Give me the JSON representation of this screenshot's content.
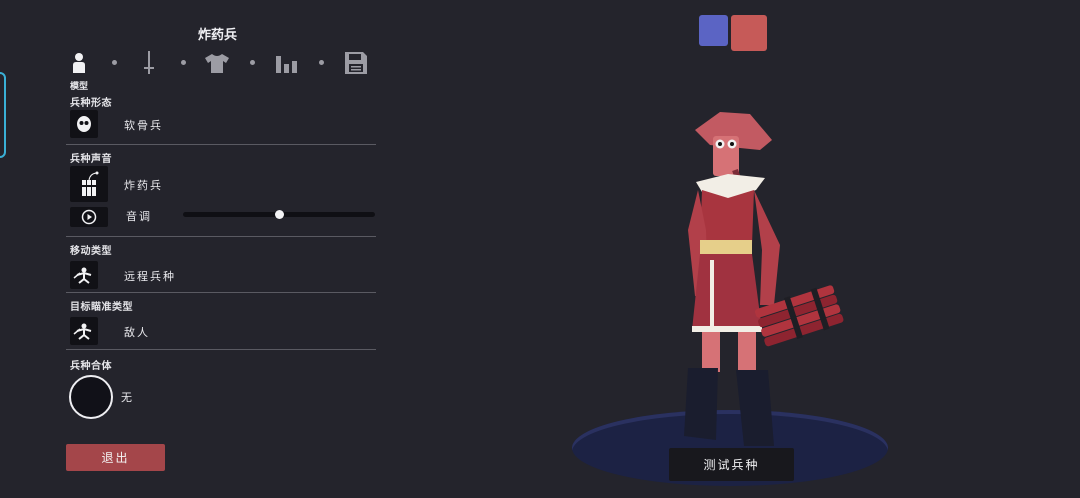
{
  "unit": {
    "title": "炸药兵"
  },
  "tabs": [
    {
      "icon": "person-icon",
      "caption": "模型"
    },
    {
      "icon": "sword-icon"
    },
    {
      "icon": "shirt-icon"
    },
    {
      "icon": "bar-chart-icon"
    },
    {
      "icon": "save-icon"
    }
  ],
  "sections": {
    "form": {
      "label": "兵种形态",
      "value": "软骨兵",
      "icon": "skull-face-icon"
    },
    "voice": {
      "label": "兵种声音",
      "value": "炸药兵",
      "icon": "dynamite-icon",
      "pitch_label": "音调",
      "pitch_value": 0.5
    },
    "movement": {
      "label": "移动类型",
      "value": "远程兵种",
      "icon": "ranged-unit-icon"
    },
    "targeting": {
      "label": "目标瞄准类型",
      "value": "敌人",
      "icon": "target-unit-icon"
    },
    "combo": {
      "label": "兵种合体",
      "value": "无"
    }
  },
  "buttons": {
    "exit": "退出",
    "test": "测试兵种"
  },
  "team_colors": [
    "#5b64c4",
    "#c65a58"
  ]
}
